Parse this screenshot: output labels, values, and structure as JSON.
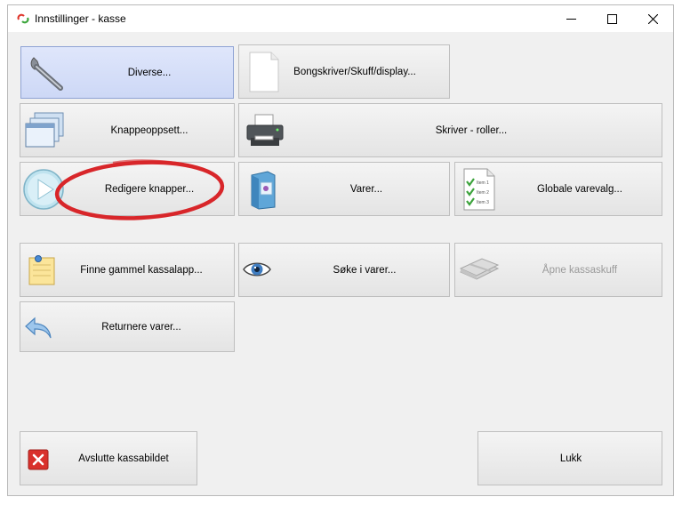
{
  "window": {
    "title": "Innstillinger - kasse",
    "controls": {
      "minimize": "—",
      "maximize": "☐",
      "close": "✕"
    }
  },
  "buttons": {
    "diverse": "Diverse...",
    "bongskriver": "Bongskriver/Skuff/display...",
    "knappeoppsett": "Knappeoppsett...",
    "skriver_roller": "Skriver - roller...",
    "redigere_knapper": "Redigere knapper...",
    "varer": "Varer...",
    "globale_varevalg": "Globale varevalg...",
    "finne_kassalapp": "Finne gammel kassalapp...",
    "soke_varer": "Søke i varer...",
    "apne_kassaskuff": "Åpne kassaskuff",
    "returnere_varer": "Returnere varer...",
    "avslutte": "Avslutte kassabildet",
    "lukk": "Lukk"
  },
  "icon_labels": {
    "item1": "Item 1",
    "item2": "Item 2",
    "item3": "Item 3"
  },
  "colors": {
    "active_button": "#cdd8f6",
    "annotation_circle": "#d8262a",
    "close_icon": "#d9312c",
    "check_green": "#3ca33c"
  }
}
